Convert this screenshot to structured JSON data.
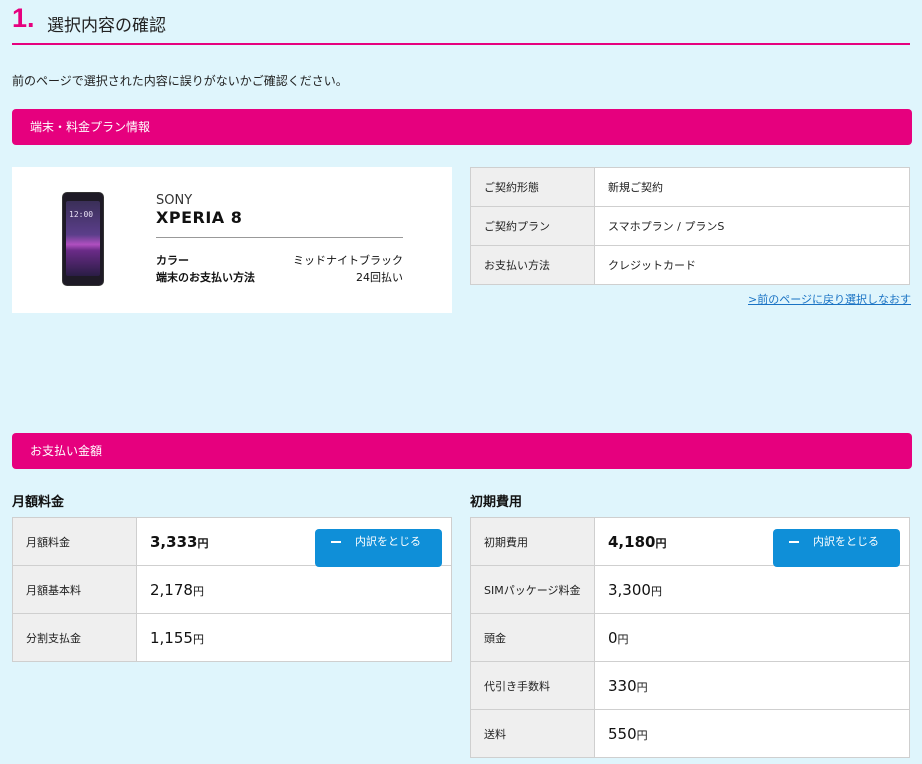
{
  "page": {
    "step_number": "1.",
    "step_title": "選択内容の確認",
    "intro": "前のページで選択された内容に誤りがないかご確認ください。"
  },
  "device_section": {
    "bar_label": "端末・料金プラン情報",
    "device": {
      "brand": "SONY",
      "model": "XPERIA 8",
      "screen_time": "12:00",
      "rows": [
        {
          "label": "カラー",
          "value": "ミッドナイトブラック"
        },
        {
          "label": "端末のお支払い方法",
          "value": "24回払い"
        }
      ]
    },
    "contract": [
      {
        "label": "ご契約形態",
        "value": "新規ご契約"
      },
      {
        "label": "ご契約プラン",
        "value": "スマホプラン / プランS"
      },
      {
        "label": "お支払い方法",
        "value": "クレジットカード"
      }
    ],
    "back_link": ">前のページに戻り選択しなおす"
  },
  "payment_section": {
    "bar_label": "お支払い金額",
    "yen": "円",
    "toggle_label": "内訳をとじる",
    "monthly": {
      "title": "月額料金",
      "rows": [
        {
          "label": "月額料金",
          "value": "3,333"
        },
        {
          "label": "月額基本料",
          "value": "2,178"
        },
        {
          "label": "分割支払金",
          "value": "1,155"
        }
      ]
    },
    "initial": {
      "title": "初期費用",
      "rows": [
        {
          "label": "初期費用",
          "value": "4,180"
        },
        {
          "label": "SIMパッケージ料金",
          "value": "3,300"
        },
        {
          "label": "頭金",
          "value": "0"
        },
        {
          "label": "代引き手数料",
          "value": "330"
        },
        {
          "label": "送料",
          "value": "550"
        }
      ]
    }
  },
  "colors": {
    "accent": "#e6007e",
    "button": "#0f8fd8",
    "link": "#1a73c4",
    "background": "#dff5fc"
  }
}
